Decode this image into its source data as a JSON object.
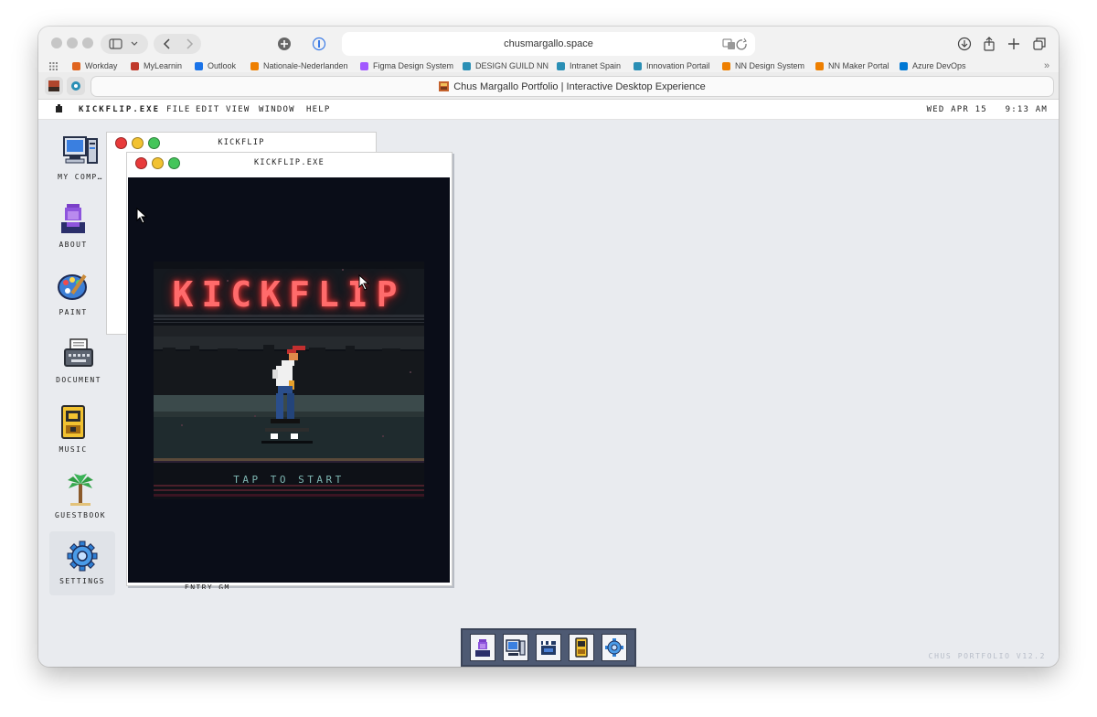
{
  "browser": {
    "url": "chusmargallo.space",
    "tab_title": "Chus Margallo Portfolio | Interactive Desktop Experience",
    "bookmarks": [
      {
        "label": "Workday",
        "color": "#e0641e"
      },
      {
        "label": "MyLearnin",
        "color": "#c0392b"
      },
      {
        "label": "Outlook",
        "color": "#1a73e8"
      },
      {
        "label": "Nationale-Nederlanden",
        "color": "#ee7f00"
      },
      {
        "label": "Figma Design System",
        "color": "#a259ff"
      },
      {
        "label": "DESIGN GUILD NN",
        "color": "#2a8fb5"
      },
      {
        "label": "Intranet Spain",
        "color": "#2a8fb5"
      },
      {
        "label": "Innovation Portail",
        "color": "#2a8fb5"
      },
      {
        "label": "NN Design System",
        "color": "#ee7f00"
      },
      {
        "label": "NN Maker Portal",
        "color": "#ee7f00"
      },
      {
        "label": "Azure DevOps",
        "color": "#0078d4"
      }
    ]
  },
  "menubar": {
    "app_name": "KICKFLIP.EXE",
    "items": [
      "FILE",
      "EDIT",
      "VIEW",
      "WINDOW",
      "HELP"
    ],
    "clock": "WED APR 15   9:13 AM"
  },
  "desktop": {
    "icons": [
      {
        "label": "MY COMP…",
        "icon": "computer-icon"
      },
      {
        "label": "ABOUT",
        "icon": "user-icon"
      },
      {
        "label": "PAINT",
        "icon": "palette-icon"
      },
      {
        "label": "DOCUMENT",
        "icon": "typewriter-icon"
      },
      {
        "label": "MUSIC",
        "icon": "cassette-icon"
      },
      {
        "label": "GUESTBOOK",
        "icon": "palm-tree-icon"
      },
      {
        "label": "SETTINGS",
        "icon": "gear-icon"
      }
    ],
    "version": "CHUS PORTFOLIO V12.2"
  },
  "windows": {
    "back_title": "KICKFLIP",
    "front_title": "KICKFLIP.EXE",
    "hidden_text": "ENTRY GM"
  },
  "game": {
    "logo": "KICKFLIP",
    "prompt": "TAP TO START"
  },
  "dock": [
    "user-icon",
    "computer-icon",
    "clapper-icon",
    "cassette-icon",
    "gear-icon"
  ],
  "colors": {
    "neon": "#ff6b6b",
    "prompt": "#7fb7b3",
    "dock": "#4e5a73"
  }
}
